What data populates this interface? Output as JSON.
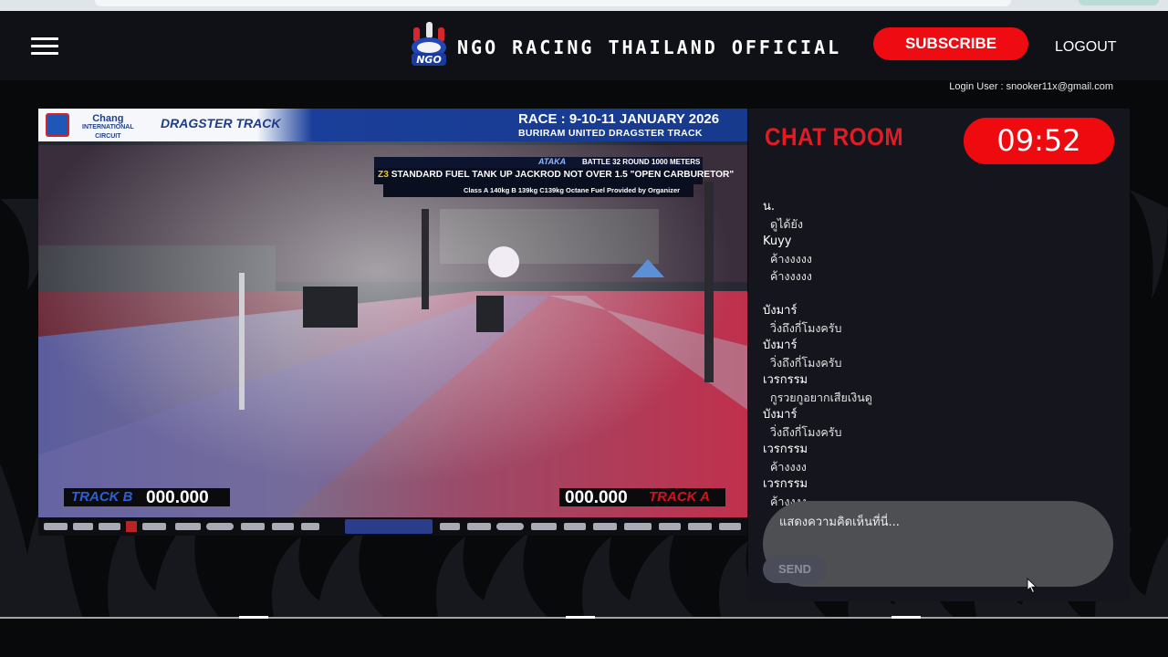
{
  "header": {
    "site_title": "NGO RACING THAILAND OFFICIAL",
    "logo_text": "NGO",
    "subscribe_label": "SUBSCRIBE",
    "logout_label": "LOGOUT",
    "login_user": "Login User : snooker11x@gmail.com"
  },
  "video": {
    "brand_line1": "Chang",
    "brand_line2": "INTERNATIONAL",
    "brand_line3": "CIRCUIT",
    "dragster_label": "DRAGSTER TRACK",
    "race_title": "RACE : 9-10-11 JANUARY 2026",
    "race_venue": "BURIRAM UNITED DRAGSTER TRACK",
    "class_brand": "ATAKA",
    "class_battle": "BATTLE 32 ROUND",
    "class_meters": "1000 METERS",
    "class_code": "Z3",
    "class_title": "STANDARD FUEL TANK UP JACKROD NOT OVER 1.5 \"OPEN CARBURETOR\"",
    "class_sub": "Class A 140kg B 139kg C139kg Octane Fuel Provided by Organizer",
    "track_b_label": "TRACK B",
    "track_b_time": "000.000",
    "track_a_label": "TRACK A",
    "track_a_time": "000.000"
  },
  "chat": {
    "title": "CHAT ROOM",
    "timer": "09:52",
    "messages": [
      {
        "user": "น.",
        "text": "ดูได้ยัง"
      },
      {
        "user": "Kuyy",
        "text": "ค้างงงงง"
      },
      {
        "user": "",
        "text": "ค้างงงงง"
      },
      {
        "user": "บังมาร์",
        "text": "วิ่งถึงกี่โมงครับ"
      },
      {
        "user": "บังมาร์",
        "text": "วิ่งถึงกี่โมงครับ"
      },
      {
        "user": "เวรกรรม",
        "text": "กูรวยกูอยากเสียเงินดู"
      },
      {
        "user": "บังมาร์",
        "text": "วิ่งถึงกี่โมงครับ"
      },
      {
        "user": "เวรกรรม",
        "text": "ค้างงงง"
      },
      {
        "user": "เวรกรรม",
        "text": "ค้างงงง"
      }
    ],
    "input_placeholder": "แสดงความคิดเห็นที่นี่...",
    "send_label": "SEND"
  },
  "colors": {
    "brand_red": "#ee0b12",
    "chat_title_red": "#e21b24",
    "track_b_blue": "#2a60d6",
    "track_a_red": "#d3121c"
  }
}
